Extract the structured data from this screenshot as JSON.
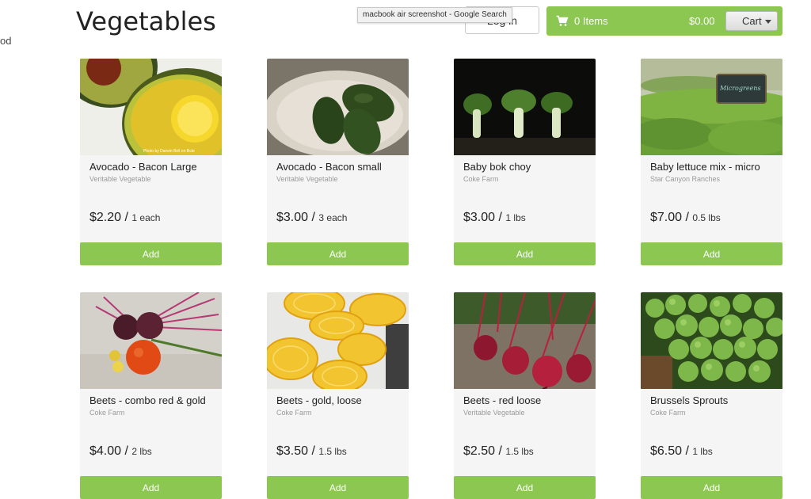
{
  "sidebar_fragment": "od",
  "page_title": "Vegetables",
  "tooltip": "macbook air screenshot - Google Search",
  "login_label": "Log in",
  "cart": {
    "items_label": "0 Items",
    "total": "$0.00",
    "dropdown_label": "Cart"
  },
  "products": [
    {
      "name": "Avocado - Bacon Large",
      "farm": "Veritable Vegetable",
      "price": "$2.20",
      "unit": "1 each",
      "add_label": "Add",
      "image_caption": "Photo by Darwin Bell on flickr"
    },
    {
      "name": "Avocado - Bacon small",
      "farm": "Veritable Vegetable",
      "price": "$3.00",
      "unit": "3 each",
      "add_label": "Add"
    },
    {
      "name": "Baby bok choy",
      "farm": "Coke Farm",
      "price": "$3.00",
      "unit": "1 lbs",
      "add_label": "Add"
    },
    {
      "name": "Baby lettuce mix - micro",
      "farm": "Star Canyon Ranches",
      "price": "$7.00",
      "unit": "0.5 lbs",
      "add_label": "Add",
      "image_sign": "Microgreens"
    },
    {
      "name": "Beets - combo red & gold",
      "farm": "Coke Farm",
      "price": "$4.00",
      "unit": "2 lbs",
      "add_label": "Add"
    },
    {
      "name": "Beets - gold, loose",
      "farm": "Coke Farm",
      "price": "$3.50",
      "unit": "1.5 lbs",
      "add_label": "Add"
    },
    {
      "name": "Beets - red loose",
      "farm": "Veritable Vegetable",
      "price": "$2.50",
      "unit": "1.5 lbs",
      "add_label": "Add"
    },
    {
      "name": "Brussels Sprouts",
      "farm": "Coke Farm",
      "price": "$6.50",
      "unit": "1 lbs",
      "add_label": "Add"
    }
  ],
  "colors": {
    "accent": "#8cc751",
    "card_bg": "#f5f5f5"
  }
}
